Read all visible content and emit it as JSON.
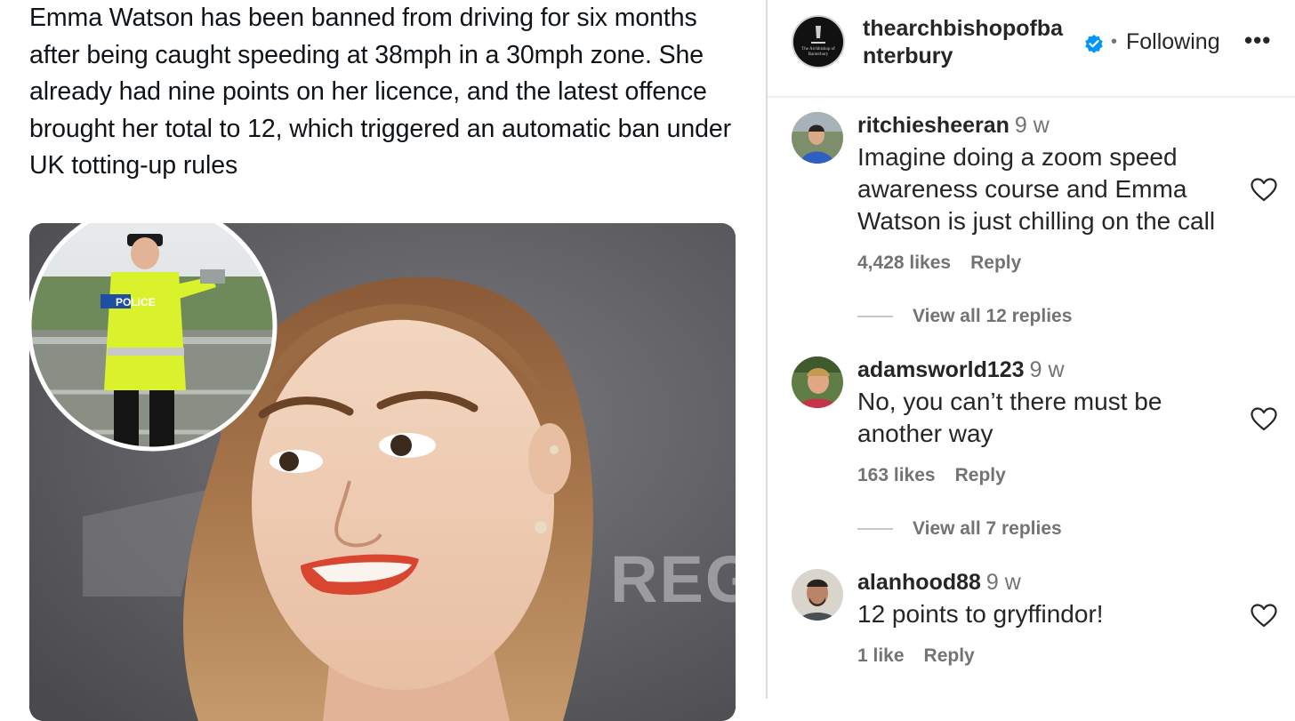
{
  "post": {
    "text": "Emma Watson has been banned from driving for six months after being caught speeding at 38mph in a 30mph zone. She already had nine points on her licence, and the latest offence brought her total to 12, which triggered an automatic ban under UK totting-up rules",
    "media": {
      "inset_badge": "POLICE",
      "background_text": "REG"
    }
  },
  "header": {
    "username": "thearchbishopofbanterbury",
    "avatar_lines": [
      "The Archbishop of",
      "Banterbury"
    ],
    "verified_icon": "verified-badge-icon",
    "separator": "•",
    "follow_label": "Following",
    "more_label": "•••"
  },
  "comments": [
    {
      "username": "ritchiesheeran",
      "time": "9 w",
      "text": "Imagine doing a zoom speed awareness course and Emma Watson is just chilling on the call",
      "likes": "4,428 likes",
      "reply_label": "Reply",
      "view_replies": "View all 12 replies"
    },
    {
      "username": "adamsworld123",
      "time": "9 w",
      "text": "No, you can’t there must be another way",
      "likes": "163 likes",
      "reply_label": "Reply",
      "view_replies": "View all 7 replies"
    },
    {
      "username": "alanhood88",
      "time": "9 w",
      "text": "12 points to gryffindor!",
      "likes": "1 like",
      "reply_label": "Reply"
    }
  ],
  "colors": {
    "text_primary": "#262626",
    "text_secondary": "#737373",
    "verified_blue": "#0095f6",
    "divider": "#dbdbdb"
  }
}
